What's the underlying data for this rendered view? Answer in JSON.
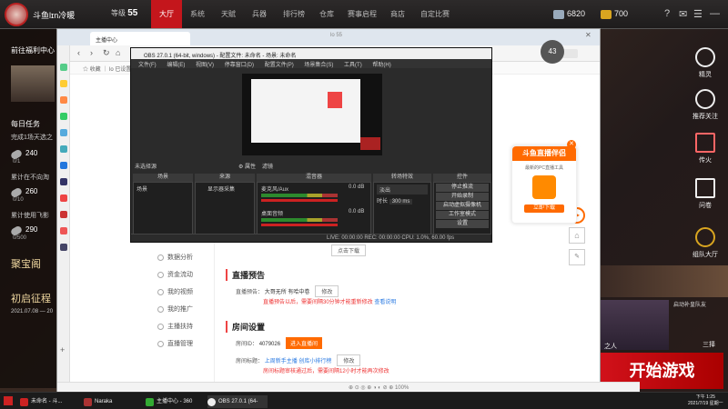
{
  "launcher": {
    "player_name": "斗鱼lɪn冷暖",
    "level_label": "等级",
    "level_value": "55",
    "tabs": [
      "大厅",
      "系统",
      "天赋",
      "兵器",
      "排行榜",
      "仓库",
      "赛事启程",
      "商店",
      "自定比赛"
    ],
    "active_tab": "大厅",
    "currency1": "6820",
    "currency2": "700"
  },
  "left_panel": {
    "promo_title": "前往福利中心",
    "daily_title": "每日任务",
    "daily_desc": "完成1场天选之",
    "items": [
      {
        "count": "240",
        "sub": "0/1"
      },
      {
        "count": "260",
        "sub": "0/10"
      },
      {
        "count": "290",
        "sub": "0/500"
      }
    ],
    "lines": [
      "累计在不向淘",
      "累计使用飞影"
    ],
    "treasure": "聚宝阁",
    "event": "初启征程",
    "event_date": "2021.07.08 — 20"
  },
  "right_panel": {
    "items": [
      "精灵",
      "推荐关注",
      "传火",
      "问卷",
      "组队大厅"
    ],
    "stream_notice": "启动补皇队友",
    "stream_name": "三择",
    "stream_sub": "之人",
    "start_game": "开始游戏"
  },
  "browser": {
    "tab_title": "主播中心",
    "address_hint": "lo 55",
    "bookmarks": "☆ 收藏  ｜  lo 已设置",
    "nav_items": [
      "数据分析",
      "资金流动",
      "我的视频",
      "我的推广",
      "主播扶持",
      "直播管理"
    ],
    "download_label": "点击下载",
    "section_preview": "直播预告",
    "preview_label": "直播预告：",
    "preview_value": "大哥无所 有哈中卷",
    "edit_label": "修改",
    "preview_warn": "直播预告以后，需要间隔30分钟才能重新修改",
    "preview_link": "查看说明",
    "section_settings": "房间设置",
    "room_id_label": "房间ID：",
    "room_id": "4079026",
    "room_btn": "进入直播间",
    "room_title_label": "房间标题：",
    "room_title": "上周新手主播 创库小排行榜",
    "title_warn": "房间标题审核通过后，需要间隔12小时才能再次修改",
    "status_bar": "⊕  ⊙  ◎  ⊕  ◑  ◐  ⊘  ⊕  100%"
  },
  "obs": {
    "title": "OBS 27.0.1 (64-bit, windows) - 配置文件: 未命名 - 场景: 未命名",
    "menu": [
      "文件(F)",
      "编辑(E)",
      "视图(V)",
      "停靠窗口(D)",
      "配置文件(P)",
      "场景集合(S)",
      "工具(T)",
      "帮助(H)"
    ],
    "scene_label": "未选择源",
    "props_label": "⚙ 属性",
    "filters_label": "滤镜",
    "docks": [
      "场景",
      "来源",
      "混音器",
      "转场特效",
      "控件"
    ],
    "scene_item": "场景",
    "source_item": "显示器采集",
    "mixer": [
      {
        "name": "麦克风/Aux",
        "db": "0.0 dB"
      },
      {
        "name": "桌面音频",
        "db": "0.0 dB"
      }
    ],
    "transition": "淡出",
    "duration_label": "时长",
    "duration_value": "300 ms",
    "controls": [
      "停止推流",
      "开始录制",
      "启动虚拟摄像机",
      "工作室模式",
      "设置",
      "退出"
    ],
    "status": "LIVE: 00:00:00    REC: 00:00:00    CPU: 1.0%, 60.00 fps"
  },
  "promo": {
    "title": "斗鱼直播伴侣",
    "sub": "最新的PC直播工具",
    "btn": "立即下载"
  },
  "taskbar": {
    "items": [
      "未命名 - 斗...",
      "Naraka",
      "主播中心 - 360极...",
      "OBS 27.0.1 (64-bit..."
    ],
    "time": "下午 1:25",
    "date": "2021/7/19 星期一"
  },
  "badge": "43",
  "colors": {
    "accent": "#c4161c",
    "brand_orange": "#ff6a00"
  }
}
